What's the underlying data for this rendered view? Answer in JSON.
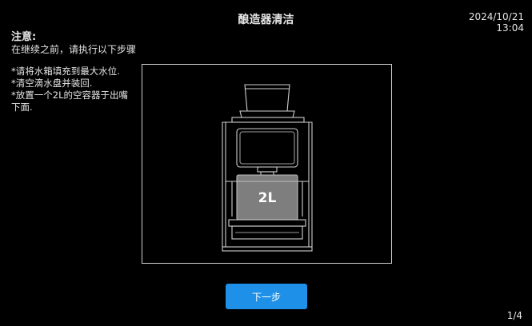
{
  "header": {
    "title": "酿造器清洁",
    "date": "2024/10/21",
    "time": "13:04"
  },
  "notice": {
    "heading": "注意:",
    "subheading": "在继续之前，请执行以下步骤"
  },
  "instructions": [
    "*请将水箱填充到最大水位.",
    "*清空滴水盘并装回.",
    "*放置一个2L的空容器于出嘴下面."
  ],
  "illustration": {
    "container_label": "2L",
    "icon": "coffee-machine-with-container-illustration"
  },
  "actions": {
    "next_label": "下一步"
  },
  "pagination": {
    "indicator": "1/4"
  },
  "colors": {
    "background": "#000000",
    "accent": "#1e90e8",
    "text": "#e6e6e6"
  }
}
